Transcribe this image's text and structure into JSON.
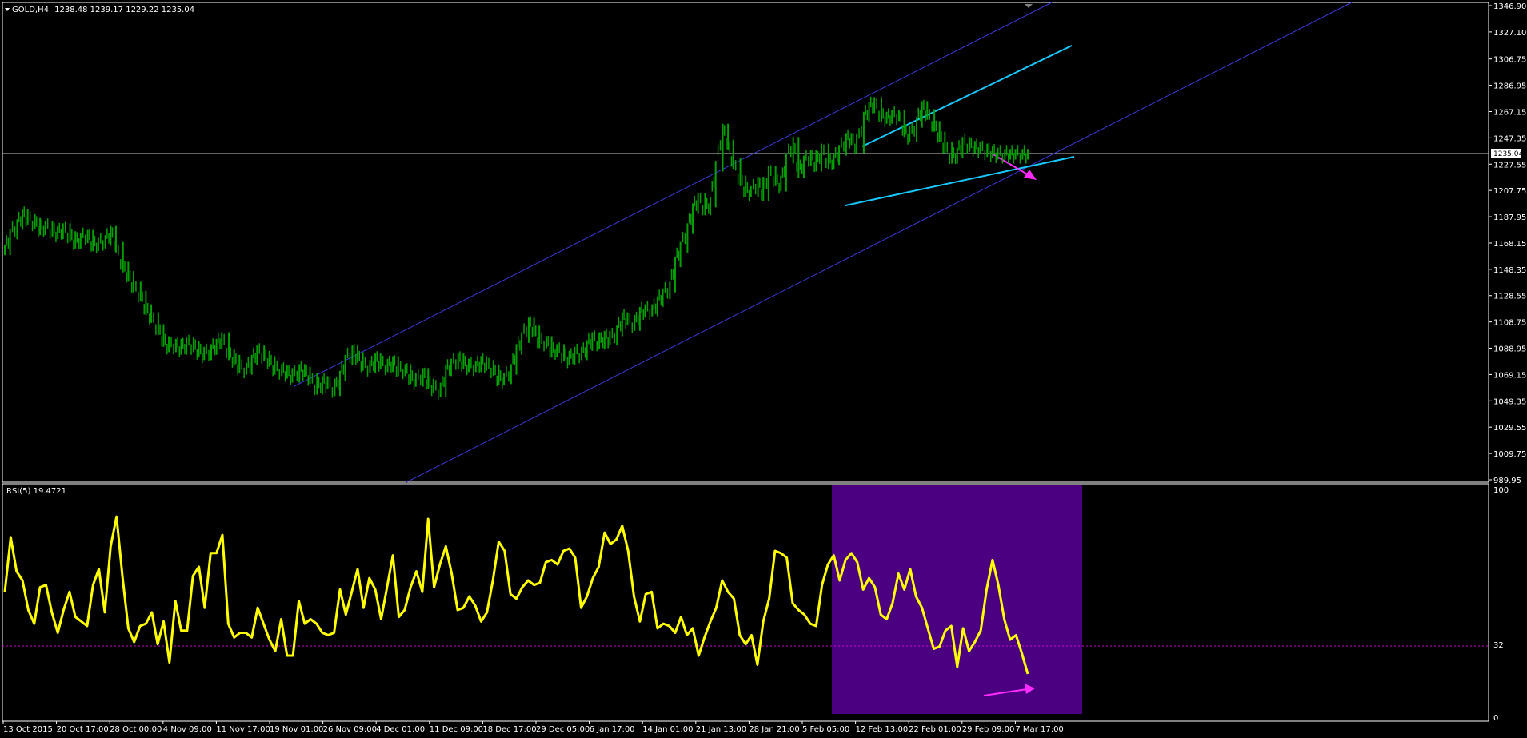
{
  "window": {
    "symbol_title": "GOLD,H4",
    "ohlc": "1238.48 1239.17 1229.22 1235.04",
    "current_price_label": "1235.04"
  },
  "colors": {
    "background": "#000000",
    "price_bars": "#00a000",
    "channel_lines": "#3b3bd8",
    "wedge_lines": "#19c8ff",
    "arrows": "#ff2bff",
    "rsi_line": "#ffff00",
    "highlight_box": "#4b0082",
    "rsi_level": "#cc00cc"
  },
  "chart_data": [
    {
      "type": "line",
      "title": "GOLD,H4",
      "price_axis_ticks": [
        1346.9,
        1327.1,
        1306.75,
        1286.95,
        1267.15,
        1247.35,
        1227.55,
        1207.75,
        1187.95,
        1168.15,
        1148.35,
        1128.55,
        1108.75,
        1088.95,
        1069.15,
        1049.35,
        1029.55,
        1009.75,
        989.95
      ],
      "ylim": [
        989.95,
        1346.9
      ],
      "x_tick_labels": [
        "13 Oct 2015",
        "20 Oct 17:00",
        "28 Oct 00:00",
        "4 Nov 09:00",
        "11 Nov 17:00",
        "19 Nov 01:00",
        "26 Nov 09:00",
        "4 Dec 01:00",
        "11 Dec 09:00",
        "18 Dec 17:00",
        "29 Dec 05:00",
        "6 Jan 17:00",
        "14 Jan 01:00",
        "21 Jan 13:00",
        "28 Jan 21:00",
        "5 Feb 05:00",
        "12 Feb 13:00",
        "22 Feb 01:00",
        "29 Feb 09:00",
        "7 Mar 17:00"
      ],
      "series": [
        {
          "name": "GOLD,H4",
          "x_index": [
            0,
            3,
            7,
            10,
            13,
            17,
            20,
            23,
            27,
            30,
            33,
            37,
            40,
            43,
            47,
            50,
            53,
            57,
            60,
            63,
            67,
            70,
            73,
            77,
            80,
            83,
            87,
            90,
            93,
            97,
            100,
            103,
            107,
            110,
            113,
            117,
            120,
            123,
            127,
            130,
            133,
            137,
            140,
            143,
            147,
            150,
            153,
            157,
            160,
            163,
            167,
            170,
            173,
            177,
            180,
            183,
            187,
            190,
            193,
            197,
            200,
            203,
            207,
            210,
            213,
            217,
            220,
            223,
            227,
            230,
            233,
            237,
            240,
            243,
            247,
            250,
            253,
            257,
            260,
            263,
            267,
            270,
            273,
            277,
            280,
            283,
            287,
            290,
            293,
            297,
            300,
            303,
            307,
            310,
            313,
            317,
            320,
            323,
            327,
            330,
            333,
            337,
            340,
            343,
            347,
            350,
            353,
            357,
            360,
            363,
            367,
            370,
            373,
            377,
            380,
            383,
            387,
            390,
            393,
            397,
            400,
            403,
            407,
            410,
            413,
            417,
            420,
            423,
            427,
            430,
            433,
            437,
            440,
            443,
            447,
            450,
            453,
            457,
            460,
            463,
            467,
            470,
            473,
            477,
            480,
            483,
            487,
            490,
            493,
            497,
            500,
            503,
            507,
            510,
            513,
            517,
            520,
            523,
            527,
            530,
            533,
            537,
            540,
            543,
            547,
            550,
            553,
            557,
            560,
            563,
            567,
            570,
            573,
            577,
            580
          ],
          "close": [
            1163,
            1175,
            1182,
            1190,
            1186,
            1183,
            1178,
            1181,
            1177,
            1175,
            1179,
            1173,
            1168,
            1172,
            1174,
            1166,
            1168,
            1170,
            1177,
            1165,
            1150,
            1143,
            1135,
            1128,
            1118,
            1112,
            1103,
            1094,
            1090,
            1092,
            1088,
            1093,
            1090,
            1086,
            1084,
            1088,
            1092,
            1097,
            1084,
            1080,
            1074,
            1073,
            1080,
            1087,
            1083,
            1079,
            1073,
            1072,
            1070,
            1067,
            1073,
            1071,
            1066,
            1058,
            1064,
            1062,
            1057,
            1068,
            1080,
            1087,
            1082,
            1076,
            1074,
            1081,
            1077,
            1075,
            1079,
            1072,
            1073,
            1066,
            1064,
            1070,
            1062,
            1059,
            1056,
            1072,
            1077,
            1081,
            1077,
            1075,
            1075,
            1079,
            1076,
            1072,
            1065,
            1066,
            1073,
            1088,
            1097,
            1108,
            1102,
            1093,
            1094,
            1086,
            1088,
            1083,
            1080,
            1086,
            1084,
            1091,
            1097,
            1092,
            1098,
            1095,
            1102,
            1112,
            1110,
            1106,
            1116,
            1118,
            1117,
            1124,
            1130,
            1135,
            1154,
            1165,
            1179,
            1194,
            1202,
            1193,
            1199,
            1226,
            1254,
            1242,
            1228,
            1215,
            1207,
            1207,
            1214,
            1204,
            1222,
            1215,
            1211,
            1232,
            1244,
            1221,
            1230,
            1234,
            1226,
            1239,
            1228,
            1231,
            1238,
            1247,
            1246,
            1240,
            1263,
            1270,
            1274,
            1263,
            1262,
            1264,
            1264,
            1252,
            1248,
            1259,
            1271,
            1265,
            1256,
            1248,
            1240,
            1232,
            1236,
            1244,
            1241,
            1240,
            1239,
            1237,
            1236,
            1235,
            1235,
            1235,
            1235,
            1235,
            1235
          ]
        }
      ]
    },
    {
      "type": "line",
      "title": "RSI(5) 19.4721",
      "ylim": [
        0,
        100
      ],
      "levels": [
        100,
        32,
        0
      ],
      "series": [
        {
          "name": "RSI(5)",
          "values": [
            55,
            79,
            64,
            60,
            47,
            41,
            57,
            58,
            46,
            37,
            47,
            55,
            44,
            42,
            40,
            58,
            65,
            46,
            75,
            88,
            62,
            39,
            33,
            40,
            41,
            46,
            32,
            42,
            24,
            51,
            38,
            38,
            62,
            66,
            48,
            72,
            72,
            80,
            41,
            35,
            37,
            37,
            35,
            48,
            41,
            34,
            29,
            43,
            27,
            27,
            51,
            41,
            43,
            41,
            37,
            36,
            37,
            56,
            45,
            55,
            65,
            48,
            61,
            56,
            43,
            57,
            71,
            44,
            47,
            57,
            64,
            55,
            87,
            57,
            67,
            75,
            63,
            47,
            48,
            53,
            49,
            42,
            46,
            60,
            77,
            73,
            54,
            52,
            57,
            60,
            58,
            59,
            68,
            69,
            67,
            73,
            74,
            70,
            48,
            53,
            61,
            66,
            81,
            76,
            78,
            84,
            73,
            53,
            42,
            54,
            55,
            39,
            41,
            40,
            37,
            44,
            36,
            39,
            27,
            35,
            42,
            48,
            60,
            55,
            52,
            36,
            32,
            36,
            23,
            42,
            52,
            73,
            72,
            70,
            50,
            47,
            45,
            41,
            40,
            58,
            67,
            71,
            60,
            69,
            72,
            68,
            56,
            61,
            57,
            45,
            43,
            50,
            63,
            56,
            65,
            53,
            48,
            39,
            30,
            31,
            38,
            40,
            22,
            39,
            29,
            33,
            38,
            56,
            69,
            58,
            43,
            34,
            36,
            28,
            19
          ]
        }
      ]
    }
  ]
}
